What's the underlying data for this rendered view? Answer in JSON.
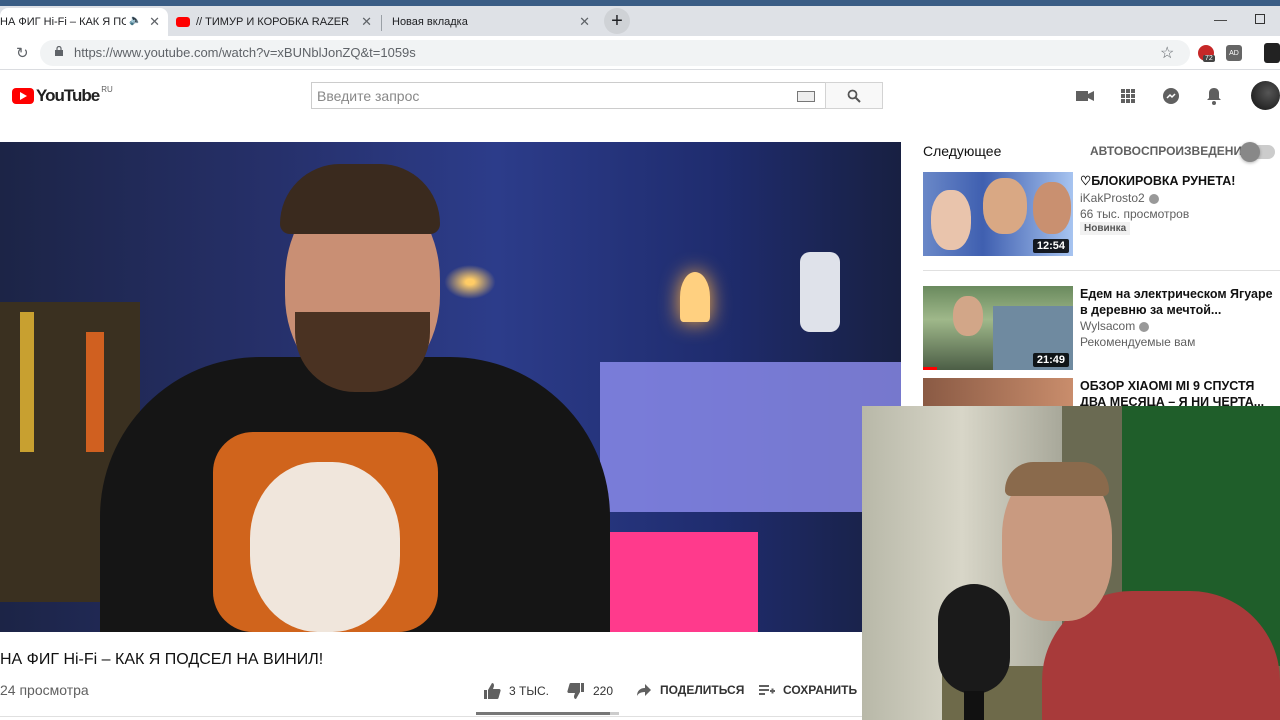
{
  "browser": {
    "tabs": [
      {
        "title": "НА ФИГ Hi-Fi – КАК Я ПО",
        "audio": true
      },
      {
        "title": "// ТИМУР И КОРОБКА RAZER ЗА"
      },
      {
        "title": "Новая вкладка"
      }
    ],
    "url": "https://www.youtube.com/watch?v=xBUNblJonZQ&t=1059s",
    "ext_badge": "72"
  },
  "youtube": {
    "logo_text": "YouTube",
    "logo_region": "RU",
    "search_placeholder": "Введите запрос"
  },
  "video": {
    "title": "НА ФИГ Hi-Fi – КАК Я ПОДСЕЛ НА ВИНИЛ!",
    "views": "24 просмотра",
    "likes": "3 ТЫС.",
    "dislikes": "220",
    "share_label": "ПОДЕЛИТЬСЯ",
    "save_label": "СОХРАНИТЬ",
    "like_ratio": 0.94
  },
  "sidebar": {
    "next_label": "Следующее",
    "autoplay_label": "АВТОВОСПРОИЗВЕДЕНИЕ",
    "items": [
      {
        "title": "♡БЛОКИРОВКА РУНЕТА!",
        "channel": "iKakProsto2",
        "views": "66 тыс. просмотров",
        "badge": "Новинка",
        "duration": "12:54"
      },
      {
        "title": "Едем на электрическом Ягуаре в деревню за мечтой...",
        "channel": "Wylsacom",
        "views": "Рекомендуемые вам",
        "duration": "21:49"
      },
      {
        "title": "ОБЗОР XIAOMI MI 9 СПУСТЯ ДВА МЕСЯЦА – Я НИ ЧЕРТА..."
      }
    ]
  },
  "colors": {
    "yt_red": "#ff0000",
    "tabbar": "#dee1e6",
    "stripe": "#3a5d85"
  }
}
